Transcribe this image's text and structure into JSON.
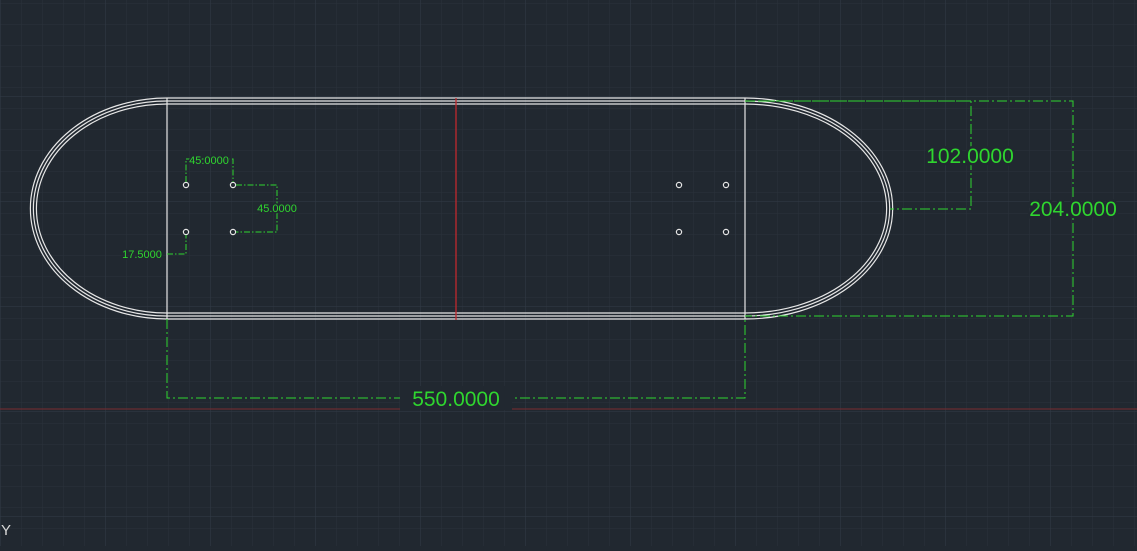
{
  "colors": {
    "background": "#212830",
    "grid_minor": "#2a323b",
    "grid_major": "#323b45",
    "outline": "#e6e6e6",
    "dimension": "#2fd62f",
    "centerline": "#c0282d",
    "axis_x": "#8a2a2e"
  },
  "dimensions": {
    "overall_length": "550.0000",
    "width": "204.0000",
    "radius": "102.0000",
    "hole_spacing_h": "45.0000",
    "hole_spacing_v": "45.0000",
    "hole_offset": "17.5000"
  },
  "ucs": {
    "y_label": "Y"
  }
}
